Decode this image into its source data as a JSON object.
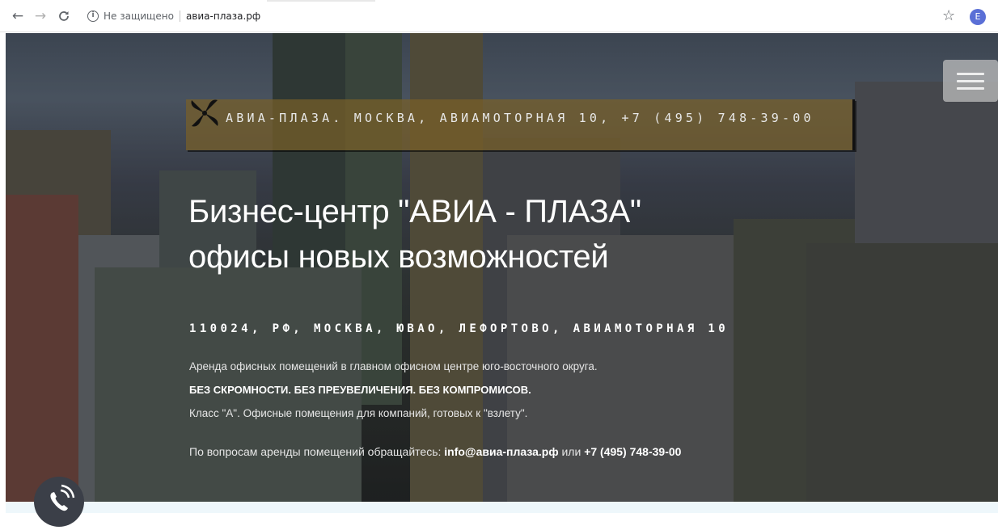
{
  "browser": {
    "insecure_label": "Не защищено",
    "url": "авиа-плаза.рф",
    "profile_initial": "E"
  },
  "hero": {
    "banner_text": "АВИА-ПЛАЗА. МОСКВА, АВИАМОТОРНАЯ 10, +7 (495) 748-39-00",
    "title_line1": "Бизнес-центр \"АВИА - ПЛАЗА\"",
    "title_line2": "офисы новых возможностей",
    "address": "110024, РФ, МОСКВА, ЮВАО, ЛЕФОРТОВО, АВИАМОТОРНАЯ 10",
    "description": "Аренда офисных помещений в главном офисном центре юго-восточного округа.",
    "tagline": "БЕЗ СКРОМНОСТИ. БЕЗ ПРЕУВЕЛИЧЕНИЯ. БЕЗ КОМПРОМИСОВ.",
    "description2": "Класс \"А\". Офисные помещения для компаний, готовых к \"взлету\".",
    "contact_prefix": "По вопросам аренды помещений обращайтесь:",
    "contact_email": "info@авиа-плаза.рф",
    "contact_or": "или",
    "contact_phone": "+7 (495) 748-39-00"
  },
  "colors": {
    "banner": "#785f28",
    "menu": "#bebebe",
    "call": "#3b3f48"
  },
  "icons": [
    "back-arrow-icon",
    "forward-arrow-icon",
    "reload-icon",
    "info-icon",
    "star-icon",
    "propeller-logo-icon",
    "hamburger-menu-icon",
    "phone-call-icon"
  ]
}
